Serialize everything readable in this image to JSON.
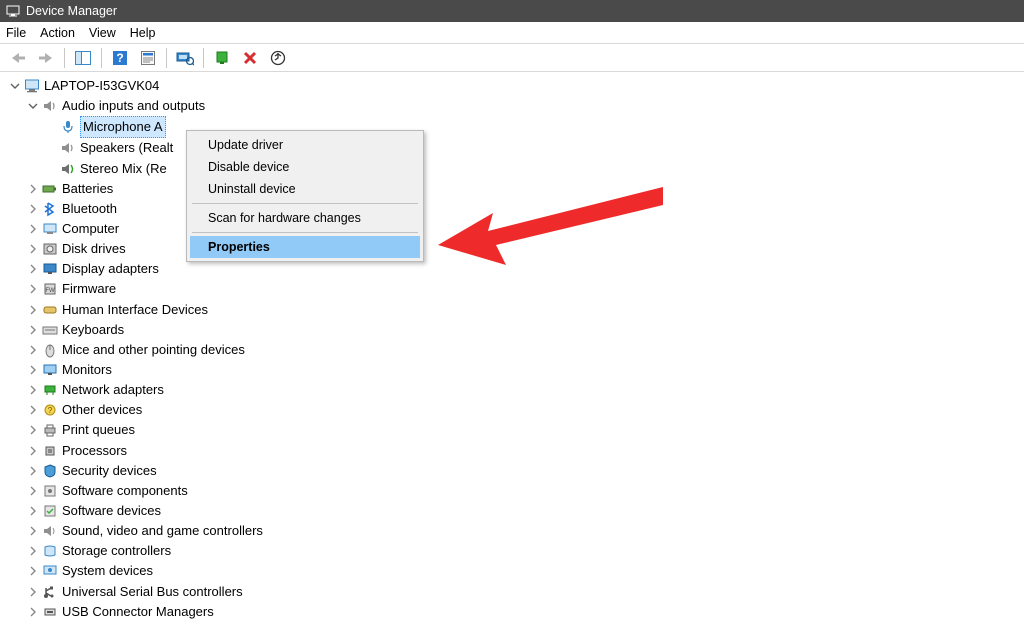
{
  "window": {
    "title": "Device Manager"
  },
  "menu": {
    "file": "File",
    "action": "Action",
    "view": "View",
    "help": "Help"
  },
  "tree": {
    "root": "LAPTOP-I53GVK04",
    "audio_cat": "Audio inputs and outputs",
    "audio_children": {
      "mic": "Microphone A",
      "speakers": "Speakers (Realt",
      "stereo": "Stereo Mix (Re"
    },
    "cats": [
      "Batteries",
      "Bluetooth",
      "Computer",
      "Disk drives",
      "Display adapters",
      "Firmware",
      "Human Interface Devices",
      "Keyboards",
      "Mice and other pointing devices",
      "Monitors",
      "Network adapters",
      "Other devices",
      "Print queues",
      "Processors",
      "Security devices",
      "Software components",
      "Software devices",
      "Sound, video and game controllers",
      "Storage controllers",
      "System devices",
      "Universal Serial Bus controllers",
      "USB Connector Managers"
    ]
  },
  "context_menu": {
    "update": "Update driver",
    "disable": "Disable device",
    "uninstall": "Uninstall device",
    "scan": "Scan for hardware changes",
    "properties": "Properties"
  },
  "cat_icons": [
    "battery-icon",
    "bluetooth-icon",
    "computer-icon",
    "disk-icon",
    "display-icon",
    "firmware-icon",
    "hid-icon",
    "keyboard-icon",
    "mouse-icon",
    "monitor-icon",
    "network-icon",
    "other-icon",
    "printer-icon",
    "cpu-icon",
    "security-icon",
    "software-comp-icon",
    "software-dev-icon",
    "sound-icon",
    "storage-icon",
    "system-icon",
    "usb-icon",
    "usb-connector-icon"
  ]
}
